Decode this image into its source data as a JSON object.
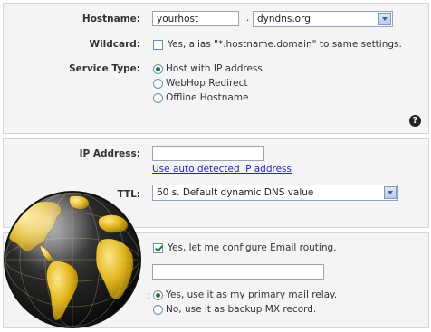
{
  "host": {
    "hostname_label": "Hostname:",
    "hostname_value": "yourhost",
    "dot": ".",
    "domain_value": "dyndns.org",
    "wildcard_label": "Wildcard:",
    "wildcard_text": "Yes, alias \"*.hostname.domain\" to same settings.",
    "wildcard_checked": false,
    "service_type_label": "Service Type:",
    "service_options": [
      {
        "label": "Host with IP address",
        "selected": true
      },
      {
        "label": "WebHop Redirect",
        "selected": false
      },
      {
        "label": "Offline Hostname",
        "selected": false
      }
    ],
    "help_glyph": "?"
  },
  "ip": {
    "ip_label": "IP Address:",
    "ip_value": "",
    "auto_link": "Use auto detected IP address",
    "ttl_label": "TTL:",
    "ttl_value": "60 s. Default dynamic DNS value"
  },
  "mx": {
    "email_routing_text": "Yes, let me configure Email routing.",
    "email_routing_checked": true,
    "mx_value": "",
    "relay_colon": ":",
    "relay_options": [
      {
        "label": "Yes, use it as my primary mail relay.",
        "selected": true
      },
      {
        "label": "No, use it as backup MX record.",
        "selected": false
      }
    ]
  },
  "colors": {
    "panel_bg": "#f4f4f4",
    "link": "#2222cc",
    "accent_green": "#1f7a2a",
    "globe_land": "#e2b51c",
    "globe_ocean": "#1a1a1a"
  }
}
